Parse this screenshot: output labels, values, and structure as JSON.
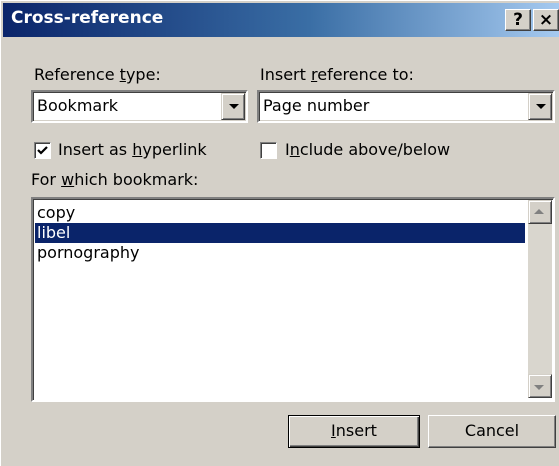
{
  "window": {
    "title": "Cross-reference",
    "help_glyph": "?",
    "close_glyph": "×"
  },
  "reference_type": {
    "label_pre": "Reference ",
    "label_accel": "t",
    "label_post": "ype:",
    "value": "Bookmark"
  },
  "insert_reference_to": {
    "label_pre": "Insert ",
    "label_accel": "r",
    "label_post": "eference to:",
    "value": "Page number"
  },
  "insert_as_hyperlink": {
    "label_pre": "Insert as ",
    "label_accel": "h",
    "label_post": "yperlink",
    "checked": true
  },
  "include_above_below": {
    "label_pre": "I",
    "label_accel": "n",
    "label_post": "clude above/below",
    "checked": false
  },
  "for_which": {
    "label_pre": "For ",
    "label_accel": "w",
    "label_post": "hich bookmark:"
  },
  "bookmarks": {
    "items": [
      {
        "label": "copy",
        "selected": false
      },
      {
        "label": "libel",
        "selected": true
      },
      {
        "label": "pornography",
        "selected": false
      }
    ]
  },
  "buttons": {
    "insert_accel": "I",
    "insert_post": "nsert",
    "cancel": "Cancel"
  },
  "colors": {
    "face": "#d4d0c8",
    "title_start": "#0a246a",
    "title_end": "#a6caf0",
    "selection": "#0a246a"
  }
}
